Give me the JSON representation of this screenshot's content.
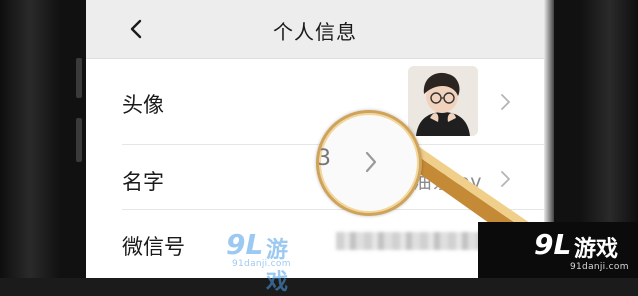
{
  "header": {
    "title": "个人信息"
  },
  "rows": [
    {
      "label": "头像"
    },
    {
      "label": "名字",
      "value": "豆浆油条 ov"
    },
    {
      "label": "微信号"
    }
  ],
  "magnifier": {
    "fragment": "3"
  },
  "watermark": {
    "logo": "9L",
    "name": "游戏",
    "site": "91danji.com"
  },
  "colors": {
    "magnifier_ring": "#d0a35a",
    "watermark_blue": "#2f8fe6",
    "navbar": "#ededed"
  }
}
